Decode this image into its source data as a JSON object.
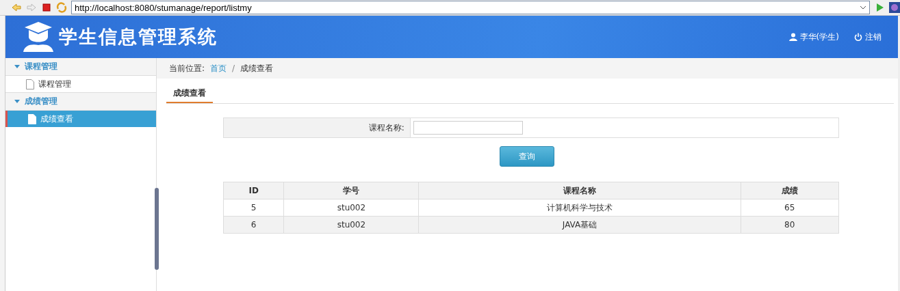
{
  "browser": {
    "url": "http://localhost:8080/stumanage/report/listmy"
  },
  "header": {
    "title": "学生信息管理系统",
    "user": "李华(学生)",
    "logout": "注销"
  },
  "sidebar": {
    "groups": [
      {
        "label": "课程管理",
        "expanded": true,
        "items": [
          {
            "label": "课程管理",
            "selected": false
          }
        ]
      },
      {
        "label": "成绩管理",
        "expanded": true,
        "items": [
          {
            "label": "成绩查看",
            "selected": true
          }
        ]
      }
    ]
  },
  "breadcrumb": {
    "prefix": "当前位置:",
    "separator": "/",
    "links": [
      {
        "label": "首页",
        "kind": "link"
      },
      {
        "label": "成绩查看",
        "kind": "current"
      }
    ]
  },
  "tab": {
    "label": "成绩查看"
  },
  "search": {
    "label": "课程名称:",
    "button": "查询"
  },
  "table": {
    "columns": [
      "ID",
      "学号",
      "课程名称",
      "成绩"
    ],
    "rows": [
      [
        "5",
        "stu002",
        "计算机科学与技术",
        "65"
      ],
      [
        "6",
        "stu002",
        "JAVA基础",
        "80"
      ]
    ]
  }
}
